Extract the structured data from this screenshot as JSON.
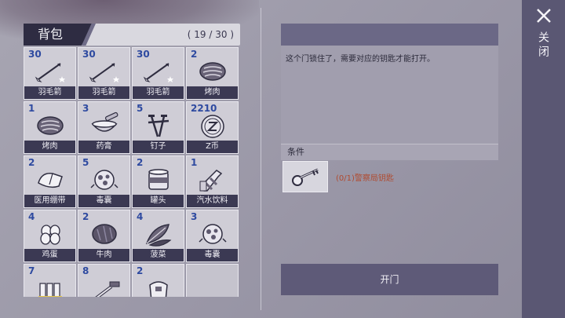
{
  "inventory": {
    "title": "背包",
    "count": "( 19 / 30 )",
    "items": [
      {
        "qty": "30",
        "label": "羽毛箭",
        "icon": "arrow-icon"
      },
      {
        "qty": "30",
        "label": "羽毛箭",
        "icon": "arrow-icon"
      },
      {
        "qty": "30",
        "label": "羽毛箭",
        "icon": "arrow-icon"
      },
      {
        "qty": "2",
        "label": "烤肉",
        "icon": "roast-meat-icon"
      },
      {
        "qty": "1",
        "label": "烤肉",
        "icon": "roast-meat-icon"
      },
      {
        "qty": "3",
        "label": "药膏",
        "icon": "ointment-bowl-icon"
      },
      {
        "qty": "5",
        "label": "钉子",
        "icon": "nails-icon"
      },
      {
        "qty": "2210",
        "label": "Z币",
        "icon": "z-coin-icon"
      },
      {
        "qty": "2",
        "label": "医用绷带",
        "icon": "bandage-icon"
      },
      {
        "qty": "5",
        "label": "毒囊",
        "icon": "poison-sac-icon"
      },
      {
        "qty": "2",
        "label": "罐头",
        "icon": "can-icon"
      },
      {
        "qty": "1",
        "label": "汽水饮料",
        "icon": "soda-bottle-icon"
      },
      {
        "qty": "4",
        "label": "鸡蛋",
        "icon": "eggs-icon"
      },
      {
        "qty": "2",
        "label": "牛肉",
        "icon": "beef-icon"
      },
      {
        "qty": "4",
        "label": "菠菜",
        "icon": "spinach-icon"
      },
      {
        "qty": "3",
        "label": "毒囊",
        "icon": "poison-sac-icon"
      },
      {
        "qty": "7",
        "label": "",
        "icon": "batteries-icon"
      },
      {
        "qty": "8",
        "label": "",
        "icon": "pipe-icon"
      },
      {
        "qty": "2",
        "label": "",
        "icon": "cloth-bag-icon"
      },
      {
        "qty": "",
        "label": "",
        "icon": ""
      }
    ]
  },
  "detail": {
    "title": "",
    "description": "这个门锁住了，需要对应的钥匙才能打开。",
    "condition_label": "条件",
    "requirement": "(0/1)警察局钥匙",
    "requirement_icon": "key-icon",
    "action_label": "开门"
  },
  "close": {
    "label": "关闭"
  },
  "colors": {
    "panel_dark": "#3b3953",
    "qty_blue": "#2e4aa0",
    "requirement_red": "#b04a2f",
    "button": "#5e5a78"
  }
}
